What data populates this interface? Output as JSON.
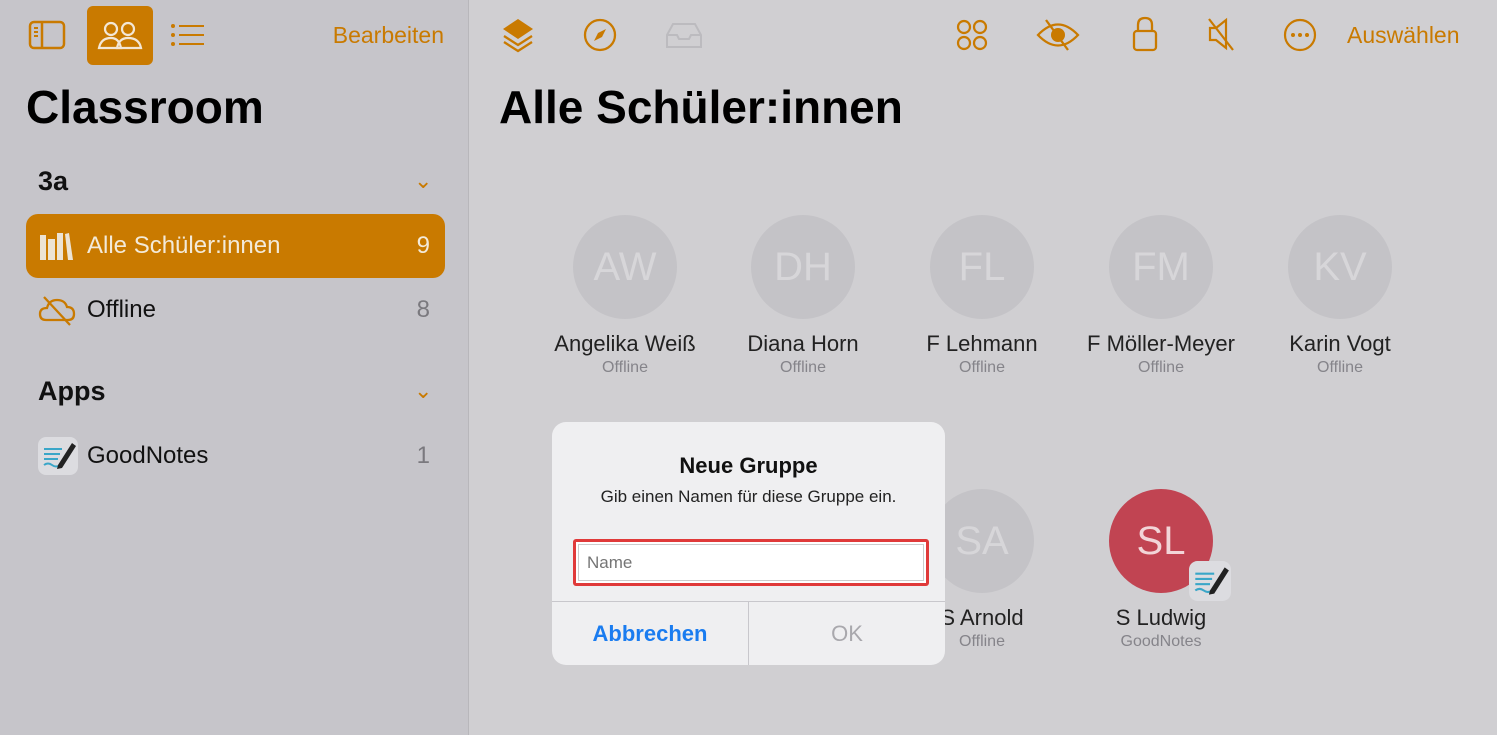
{
  "sidebar": {
    "edit_label": "Bearbeiten",
    "title": "Classroom",
    "sections": [
      {
        "title": "3a",
        "items": [
          {
            "label": "Alle Schüler:innen",
            "count": "9",
            "icon": "books-icon",
            "selected": true
          },
          {
            "label": "Offline",
            "count": "8",
            "icon": "cloud-offline-icon",
            "selected": false
          }
        ]
      },
      {
        "title": "Apps",
        "items": [
          {
            "label": "GoodNotes",
            "count": "1",
            "icon": "goodnotes-app-icon",
            "selected": false
          }
        ]
      }
    ]
  },
  "toolbar": {
    "select_label": "Auswählen"
  },
  "main": {
    "title": "Alle Schüler:innen",
    "students": [
      {
        "initials": "AW",
        "name": "Angelika Weiß",
        "status": "Offline"
      },
      {
        "initials": "DH",
        "name": "Diana Horn",
        "status": "Offline"
      },
      {
        "initials": "FL",
        "name": "F Lehmann",
        "status": "Offline"
      },
      {
        "initials": "FM",
        "name": "F Möller-Meyer",
        "status": "Offline"
      },
      {
        "initials": "KV",
        "name": "Karin Vogt",
        "status": "Offline"
      },
      {
        "initials": "SA",
        "name": "S Arnold",
        "status": "Offline"
      },
      {
        "initials": "SL",
        "name": "S Ludwig",
        "status": "GoodNotes"
      }
    ]
  },
  "dialog": {
    "title": "Neue Gruppe",
    "message": "Gib einen Namen für diese Gruppe ein.",
    "input_value": "",
    "input_placeholder": "Name",
    "cancel_label": "Abbrechen",
    "ok_label": "OK"
  },
  "colors": {
    "accent": "#c97a00",
    "cancel": "#1a7cf0",
    "active_student": "#c14452",
    "highlight": "#e03a3a"
  }
}
